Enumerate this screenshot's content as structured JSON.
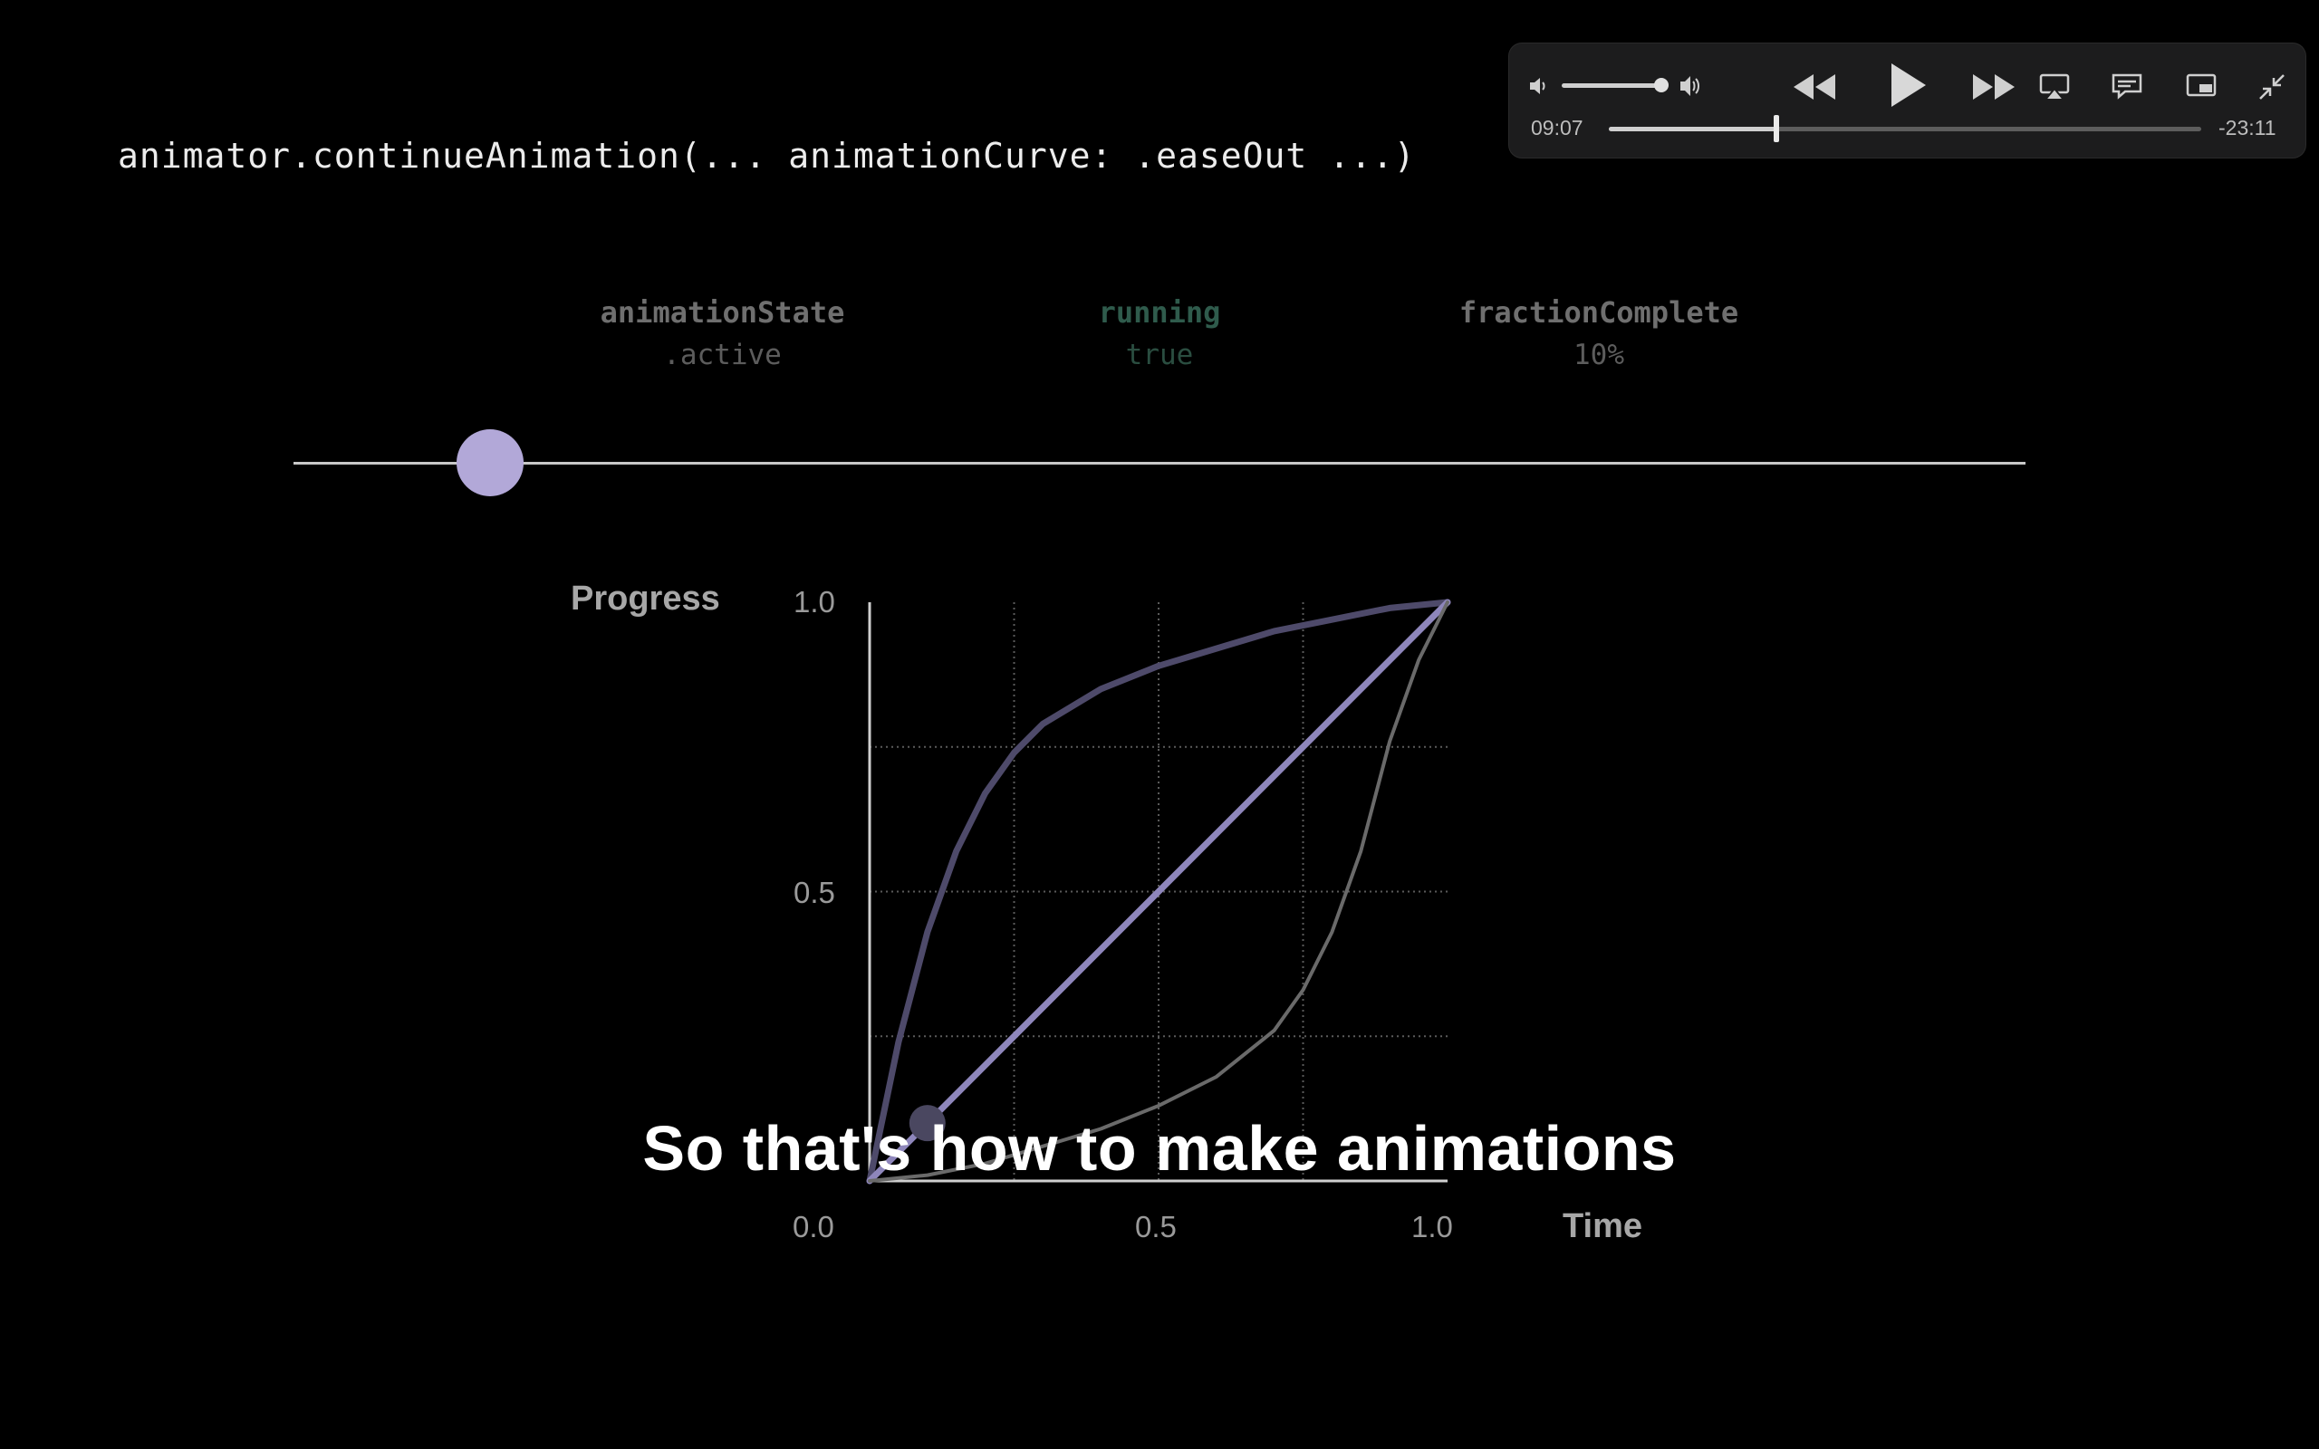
{
  "code": {
    "line": "animator.continueAnimation(... animationCurve: .easeOut ...)"
  },
  "state": [
    {
      "key": "animationState",
      "value": ".active"
    },
    {
      "key": "running",
      "value": "true"
    },
    {
      "key": "fractionComplete",
      "value": "10%"
    }
  ],
  "scrubber": {
    "fraction": 0.113
  },
  "chart": {
    "y_title": "Progress",
    "x_title": "Time",
    "y_ticks": [
      "1.0",
      "0.5"
    ],
    "x_ticks": [
      "0.0",
      "0.5",
      "1.0"
    ]
  },
  "chart_data": {
    "type": "line",
    "xlabel": "Time",
    "ylabel": "Progress",
    "xlim": [
      0,
      1
    ],
    "ylim": [
      0,
      1
    ],
    "grid": true,
    "series": [
      {
        "curve": "easeOut",
        "x": [
          0,
          0.05,
          0.1,
          0.15,
          0.2,
          0.25,
          0.3,
          0.4,
          0.5,
          0.6,
          0.7,
          0.8,
          0.9,
          1.0
        ],
        "y": [
          0,
          0.24,
          0.43,
          0.57,
          0.67,
          0.74,
          0.79,
          0.85,
          0.89,
          0.92,
          0.95,
          0.97,
          0.99,
          1.0
        ],
        "color": "#4e4a6a"
      },
      {
        "curve": "linear",
        "x": [
          0,
          1
        ],
        "y": [
          0,
          1
        ],
        "color": "#8e86bb"
      },
      {
        "curve": "easeIn",
        "x": [
          0,
          0.1,
          0.2,
          0.3,
          0.4,
          0.5,
          0.6,
          0.7,
          0.75,
          0.8,
          0.85,
          0.9,
          0.95,
          1.0
        ],
        "y": [
          0,
          0.01,
          0.03,
          0.06,
          0.09,
          0.13,
          0.18,
          0.26,
          0.33,
          0.43,
          0.57,
          0.76,
          0.9,
          1.0
        ],
        "color": "#6a6a6a"
      }
    ],
    "marker": {
      "x": 0.1,
      "y": 0.1
    }
  },
  "subtitle": "So that's how to make animations",
  "player": {
    "elapsed": "09:07",
    "remaining": "-23:11",
    "progress": 0.283,
    "volume": 0.95,
    "icons": [
      "volume-low-icon",
      "volume-high-icon",
      "rewind-icon",
      "play-icon",
      "fast-forward-icon",
      "airplay-icon",
      "subtitles-icon",
      "picture-in-picture-icon",
      "exit-fullscreen-icon"
    ]
  }
}
